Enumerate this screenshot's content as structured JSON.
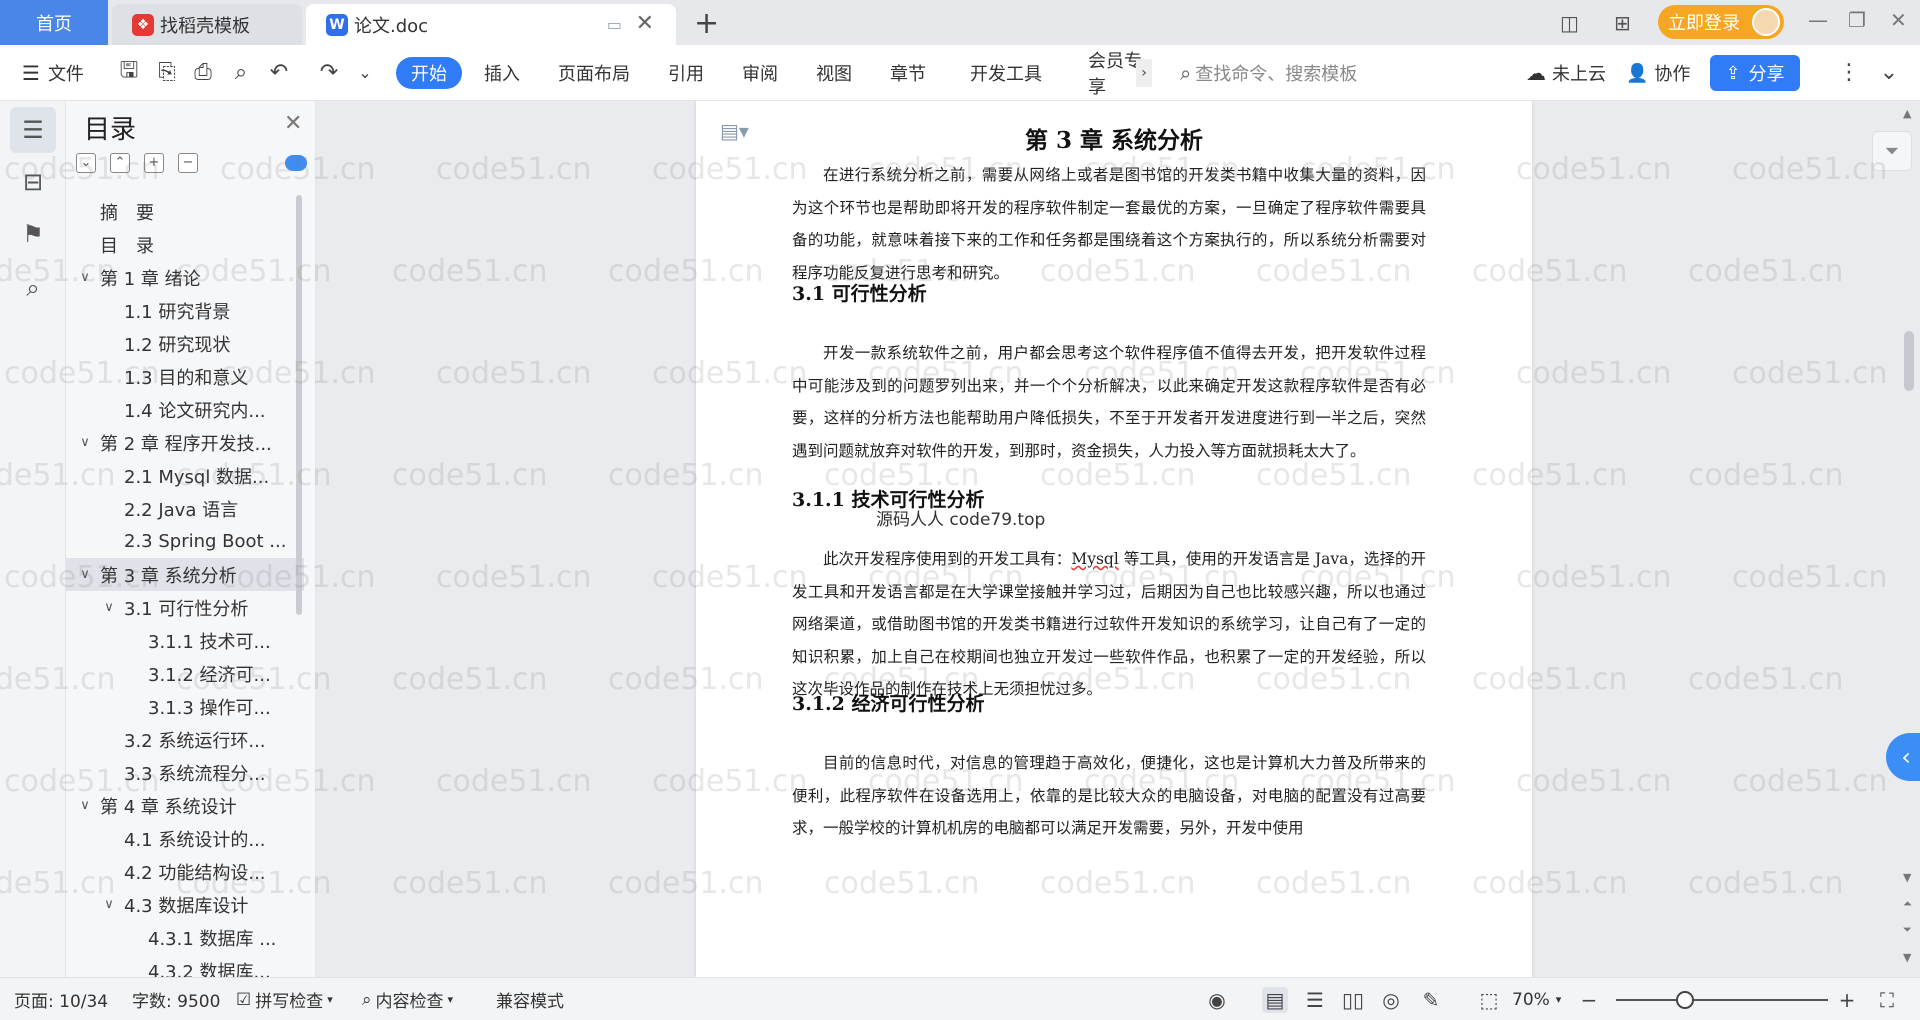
{
  "tabs": {
    "home": "首页",
    "templates": "找稻壳模板",
    "document": "论文.doc",
    "add": "+"
  },
  "account": {
    "login_label": "立即登录"
  },
  "toolbar": {
    "file_label": "文件",
    "menu_tabs": [
      "开始",
      "插入",
      "页面布局",
      "引用",
      "审阅",
      "视图",
      "章节",
      "开发工具",
      "会员专享"
    ],
    "search_placeholder": "查找命令、搜索模板",
    "cloud_label": "未上云",
    "collab_label": "协作",
    "share_label": "分享"
  },
  "toc": {
    "title": "目录",
    "items": [
      {
        "label": "摘　要",
        "level": 0,
        "chev": ""
      },
      {
        "label": "目　录",
        "level": 0,
        "chev": ""
      },
      {
        "label": "第 1 章  绪论",
        "level": 0,
        "chev": "∨"
      },
      {
        "label": "1.1 研究背景",
        "level": 1,
        "chev": ""
      },
      {
        "label": "1.2  研究现状",
        "level": 1,
        "chev": ""
      },
      {
        "label": "1.3  目的和意义",
        "level": 1,
        "chev": ""
      },
      {
        "label": "1.4  论文研究内...",
        "level": 1,
        "chev": ""
      },
      {
        "label": "第 2 章  程序开发技...",
        "level": 0,
        "chev": "∨"
      },
      {
        "label": "2.1 Mysql 数据...",
        "level": 1,
        "chev": ""
      },
      {
        "label": "2.2 Java 语言",
        "level": 1,
        "chev": ""
      },
      {
        "label": "2.3 Spring Boot ...",
        "level": 1,
        "chev": ""
      },
      {
        "label": "第 3 章  系统分析",
        "level": 0,
        "chev": "∨",
        "active": true
      },
      {
        "label": "3.1 可行性分析",
        "level": 1,
        "chev": "∨"
      },
      {
        "label": "3.1.1 技术可...",
        "level": 2,
        "chev": ""
      },
      {
        "label": "3.1.2 经济可...",
        "level": 2,
        "chev": ""
      },
      {
        "label": "3.1.3 操作可...",
        "level": 2,
        "chev": ""
      },
      {
        "label": "3.2 系统运行环...",
        "level": 1,
        "chev": ""
      },
      {
        "label": "3.3 系统流程分...",
        "level": 1,
        "chev": ""
      },
      {
        "label": "第 4 章  系统设计",
        "level": 0,
        "chev": "∨"
      },
      {
        "label": "4.1  系统设计的...",
        "level": 1,
        "chev": ""
      },
      {
        "label": "4.2  功能结构设...",
        "level": 1,
        "chev": ""
      },
      {
        "label": "4.3  数据库设计",
        "level": 1,
        "chev": "∨"
      },
      {
        "label": "4.3.1  数据库 ...",
        "level": 2,
        "chev": ""
      },
      {
        "label": "4.3.2  数据库...",
        "level": 2,
        "chev": ""
      }
    ]
  },
  "document": {
    "chapter_title": "第 3 章  系统分析",
    "intro": "在进行系统分析之前，需要从网络上或者是图书馆的开发类书籍中收集大量的资料，因为这个环节也是帮助即将开发的程序软件制定一套最优的方案，一旦确定了程序软件需要具备的功能，就意味着接下来的工作和任务都是围绕着这个方案执行的，所以系统分析需要对程序功能反复进行思考和研究。",
    "s31_title": "3.1 可行性分析",
    "s31_body": "开发一款系统软件之前，用户都会思考这个软件程序值不值得去开发，把开发软件过程中可能涉及到的问题罗列出来，并一个个分析解决，以此来确定开发这款程序软件是否有必要，这样的分析方法也能帮助用户降低损失，不至于开发者开发进度进行到一半之后，突然遇到问题就放弃对软件的开发，到那时，资金损失，人力投入等方面就损耗太大了。",
    "overlay": "源码人人 code79.top",
    "s311_title": "3.1.1 技术可行性分析",
    "s311_body_pre": "此次开发程序使用到的开发工具有：",
    "s311_body_spell": "Mysql",
    "s311_body_post": " 等工具，使用的开发语言是 Java，选择的开发工具和开发语言都是在大学课堂接触并学习过，后期因为自己也比较感兴趣，所以也通过网络渠道，或借助图书馆的开发类书籍进行过软件开发知识的系统学习，让自己有了一定的知识积累，加上自己在校期间也独立开发过一些软件作品，也积累了一定的开发经验，所以这次毕设作品的制作在技术上无须担忧过多。",
    "s312_title": "3.1.2 经济可行性分析",
    "s312_body": "目前的信息时代，对信息的管理趋于高效化，便捷化，这也是计算机大力普及所带来的便利，此程序软件在设备选用上，依靠的是比较大众的电脑设备，对电脑的配置没有过高要求，一般学校的计算机机房的电脑都可以满足开发需要，另外，开发中使用"
  },
  "watermark": "code51.cn",
  "status": {
    "page": "页面: 10/34",
    "words": "字数: 9500",
    "spellcheck": "拼写检查",
    "contentcheck": "内容检查",
    "compat": "兼容模式",
    "zoom": "70%"
  },
  "colors": {
    "accent": "#2f7cf6",
    "home_tab": "#4a86e8",
    "login": "#f5a623"
  }
}
